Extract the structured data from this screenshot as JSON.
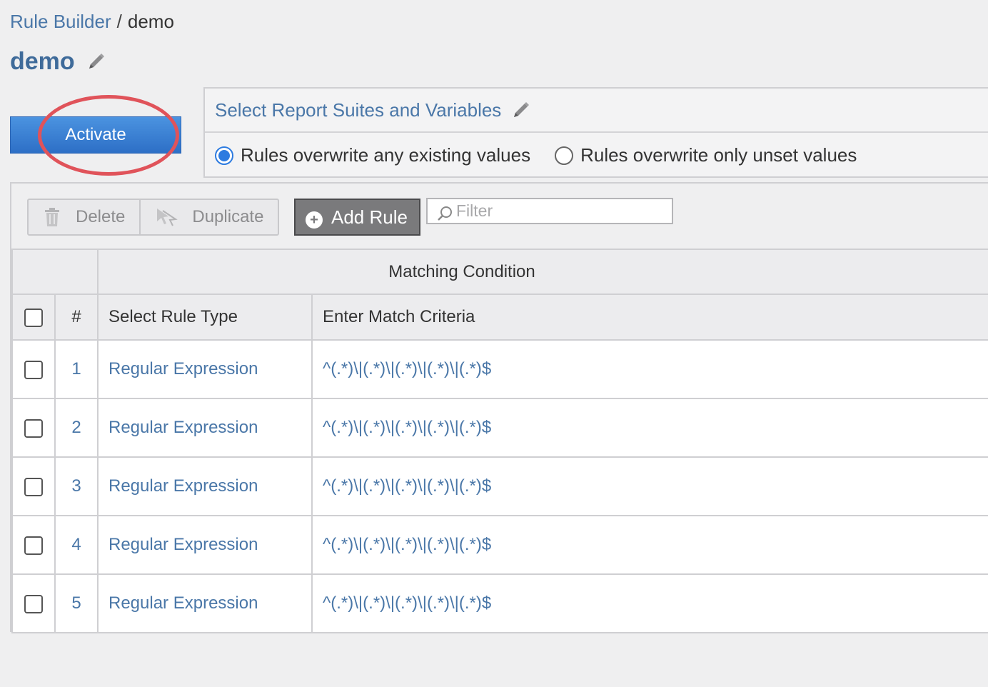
{
  "breadcrumb": {
    "parent": "Rule Builder",
    "separator": "/",
    "current": "demo"
  },
  "page_title": "demo",
  "activate_label": "Activate",
  "report_suites": {
    "title": "Select Report Suites and Variables",
    "options": [
      {
        "label": "Rules overwrite any existing values",
        "checked": true
      },
      {
        "label": "Rules overwrite only unset values",
        "checked": false
      }
    ]
  },
  "toolbar": {
    "delete_label": "Delete",
    "duplicate_label": "Duplicate",
    "add_rule_label": "Add Rule",
    "filter_placeholder": "Filter"
  },
  "table": {
    "group_header": "Matching Condition",
    "columns": {
      "number": "#",
      "rule_type": "Select Rule Type",
      "criteria": "Enter Match Criteria"
    },
    "rows": [
      {
        "number": "1",
        "rule_type": "Regular Expression",
        "criteria": "^(.*)\\|(.*)\\|(.*)\\|(.*)\\|(.*)$"
      },
      {
        "number": "2",
        "rule_type": "Regular Expression",
        "criteria": "^(.*)\\|(.*)\\|(.*)\\|(.*)\\|(.*)$"
      },
      {
        "number": "3",
        "rule_type": "Regular Expression",
        "criteria": "^(.*)\\|(.*)\\|(.*)\\|(.*)\\|(.*)$"
      },
      {
        "number": "4",
        "rule_type": "Regular Expression",
        "criteria": "^(.*)\\|(.*)\\|(.*)\\|(.*)\\|(.*)$"
      },
      {
        "number": "5",
        "rule_type": "Regular Expression",
        "criteria": "^(.*)\\|(.*)\\|(.*)\\|(.*)\\|(.*)$"
      }
    ]
  },
  "colors": {
    "accent": "#2d6fc6",
    "link": "#4a77a8",
    "highlight_ring": "#e0535a"
  }
}
